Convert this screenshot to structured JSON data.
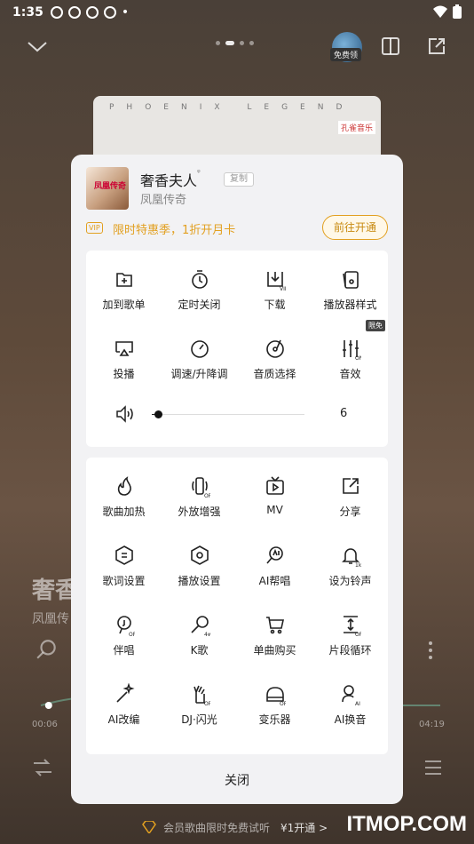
{
  "status_bar": {
    "time": "1:35",
    "notif_icons": [
      "K",
      "◆",
      "K",
      "◆"
    ],
    "dot": "•"
  },
  "top_bar": {
    "free_tag": "免费领",
    "page_dots": 4,
    "active_dot": 1
  },
  "cover_card": {
    "brand_text": "PHOENIX LEGEND",
    "logo_text": "孔雀音乐"
  },
  "background_player": {
    "title": "奢香",
    "artist": "凤凰传",
    "time_elapsed": "00:06",
    "time_total": "04:19",
    "progress_fraction": 0.02
  },
  "sheet": {
    "song_title": "奢香夫人",
    "title_q": "ᵠ",
    "copy_label": "复制",
    "artist": "凤凰传奇",
    "album_art_text": "凤凰传奇",
    "vip_badge": "VIP",
    "vip_promo": "限时特惠季，1折开月卡",
    "vip_button": "前往开通",
    "menu_group_1": [
      {
        "label": "加到歌单",
        "icon": "add-to-playlist-icon"
      },
      {
        "label": "定时关闭",
        "icon": "timer-icon"
      },
      {
        "label": "下载",
        "icon": "download-icon"
      },
      {
        "label": "播放器样式",
        "icon": "player-style-icon"
      },
      {
        "label": "投播",
        "icon": "cast-icon"
      },
      {
        "label": "调速/升降调",
        "icon": "speed-icon"
      },
      {
        "label": "音质选择",
        "icon": "audio-quality-icon"
      },
      {
        "label": "音效",
        "icon": "equalizer-icon",
        "badge": "限免"
      }
    ],
    "volume": {
      "value": "6",
      "fraction": 0.04
    },
    "menu_group_2": [
      {
        "label": "歌曲加热",
        "icon": "flame-icon"
      },
      {
        "label": "外放增强",
        "icon": "speaker-boost-icon"
      },
      {
        "label": "MV",
        "icon": "mv-icon"
      },
      {
        "label": "分享",
        "icon": "share-icon"
      },
      {
        "label": "歌词设置",
        "icon": "lyrics-icon"
      },
      {
        "label": "播放设置",
        "icon": "settings-icon"
      },
      {
        "label": "AI帮唱",
        "icon": "ai-sing-icon"
      },
      {
        "label": "设为铃声",
        "icon": "ringtone-icon"
      },
      {
        "label": "伴唱",
        "icon": "karaoke-icon"
      },
      {
        "label": "K歌",
        "icon": "mic-icon"
      },
      {
        "label": "单曲购买",
        "icon": "cart-icon"
      },
      {
        "label": "片段循环",
        "icon": "loop-segment-icon"
      },
      {
        "label": "AI改编",
        "icon": "ai-remix-icon"
      },
      {
        "label": "DJ·闪光",
        "icon": "dj-icon"
      },
      {
        "label": "变乐器",
        "icon": "piano-icon"
      },
      {
        "label": "AI换音",
        "icon": "ai-voice-icon"
      }
    ],
    "close_label": "关闭"
  },
  "promo_bar": {
    "text": "会员歌曲限时免费试听",
    "cta": "¥1开通 >"
  },
  "watermark": "ITMOP.COM",
  "colors": {
    "accent": "#e2a020",
    "sheet_bg": "#f2f2f4"
  }
}
